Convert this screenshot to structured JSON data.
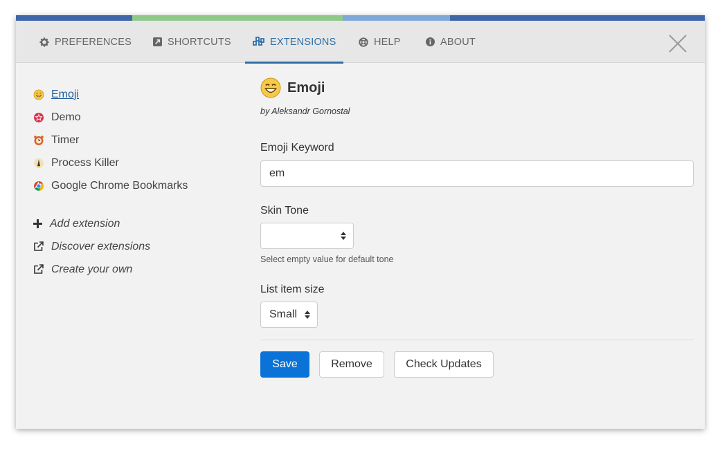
{
  "tabs": [
    {
      "label": "PREFERENCES",
      "icon": "gear-icon"
    },
    {
      "label": "SHORTCUTS",
      "icon": "shortcut-icon"
    },
    {
      "label": "EXTENSIONS",
      "icon": "cubes-icon",
      "active": true
    },
    {
      "label": "HELP",
      "icon": "life-ring-icon"
    },
    {
      "label": "ABOUT",
      "icon": "info-icon"
    }
  ],
  "sidebar": {
    "extensions": [
      {
        "label": "Emoji",
        "icon": "emoji-icon",
        "active": true
      },
      {
        "label": "Demo",
        "icon": "demo-icon"
      },
      {
        "label": "Timer",
        "icon": "timer-icon"
      },
      {
        "label": "Process Killer",
        "icon": "process-killer-icon"
      },
      {
        "label": "Google Chrome Bookmarks",
        "icon": "chrome-icon"
      }
    ],
    "actions": [
      {
        "label": "Add extension",
        "icon": "plus-icon"
      },
      {
        "label": "Discover extensions",
        "icon": "external-link-icon"
      },
      {
        "label": "Create your own",
        "icon": "external-link-icon"
      }
    ]
  },
  "extension": {
    "title": "Emoji",
    "author": "by Aleksandr Gornostal",
    "keyword_label": "Emoji Keyword",
    "keyword_value": "em",
    "skin_tone_label": "Skin Tone",
    "skin_tone_value": "",
    "skin_tone_help": "Select empty value for default tone",
    "item_size_label": "List item size",
    "item_size_value": "Small"
  },
  "buttons": {
    "save": "Save",
    "remove": "Remove",
    "check_updates": "Check Updates"
  },
  "colors": {
    "accent": "#2e6fa8",
    "primary_button": "#0b73d8",
    "link": "#1f5c99"
  }
}
